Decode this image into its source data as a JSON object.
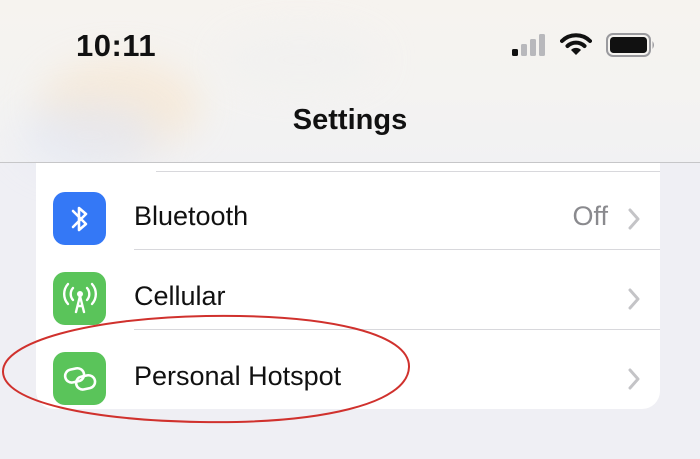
{
  "status_bar": {
    "time": "10:11",
    "icons": [
      "cellular-signal-icon",
      "wifi-icon",
      "battery-icon"
    ]
  },
  "nav": {
    "title": "Settings"
  },
  "settings": {
    "rows": [
      {
        "label": "Bluetooth",
        "value": "Off",
        "icon": "bluetooth-icon",
        "icon_color": "#3478f6"
      },
      {
        "label": "Cellular",
        "value": "",
        "icon": "cellular-antenna-icon",
        "icon_color": "#5ac45a"
      },
      {
        "label": "Personal Hotspot",
        "value": "",
        "icon": "hotspot-link-icon",
        "icon_color": "#5ac45a"
      }
    ]
  },
  "annotation": {
    "shape": "ellipse",
    "color": "#d0312d",
    "target": "Personal Hotspot"
  }
}
